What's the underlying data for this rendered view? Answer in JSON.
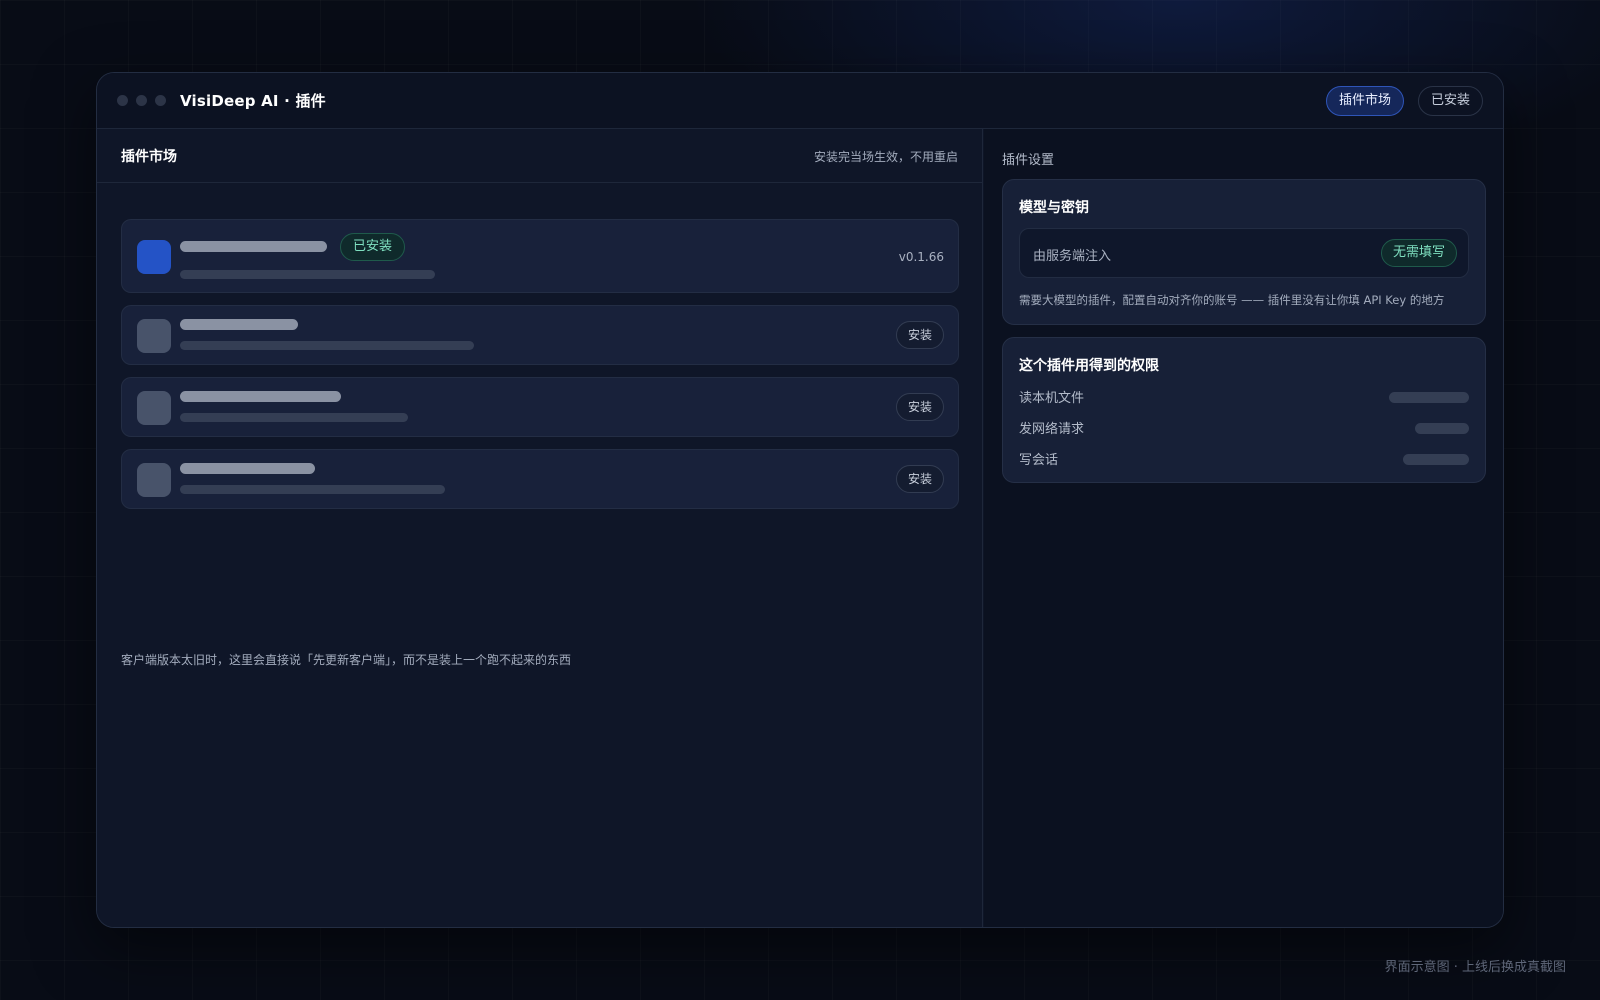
{
  "window": {
    "title": "VisiDeep AI · 插件",
    "tabs": [
      {
        "label": "插件市场",
        "active": true
      },
      {
        "label": "已安装",
        "active": false
      }
    ]
  },
  "market": {
    "title": "插件市场",
    "hint": "安装完当场生效，不用重启",
    "plugins": [
      {
        "installed_badge": "已安装",
        "version": "v0.1.66",
        "icon_color": "#2453c6"
      },
      {
        "action": "安装",
        "icon_color": "#48536a"
      },
      {
        "action": "安装",
        "icon_color": "#48536a"
      },
      {
        "action": "安装",
        "icon_color": "#48536a"
      }
    ],
    "footnote": "客户端版本太旧时，这里会直接说「先更新客户端」，而不是装上一个跑不起来的东西"
  },
  "settings": {
    "heading": "插件设置",
    "key_card": {
      "title": "模型与密钥",
      "inject_label": "由服务端注入",
      "badge": "无需填写",
      "note": "需要大模型的插件，配置自动对齐你的账号 —— 插件里没有让你填 API Key 的地方"
    },
    "permissions_card": {
      "title": "这个插件用得到的权限",
      "items": [
        {
          "label": "读本机文件"
        },
        {
          "label": "发网络请求"
        },
        {
          "label": "写会话"
        }
      ]
    }
  },
  "watermark": "界面示意图 · 上线后换成真截图",
  "colors": {
    "accent": "#2f55b8",
    "success": "#7fe0c0",
    "background": "#080c16"
  }
}
